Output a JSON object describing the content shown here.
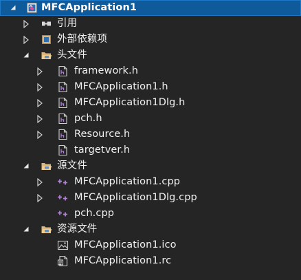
{
  "project": {
    "label": "MFCApplication1",
    "icon": "project-icon"
  },
  "references": {
    "label": "引用",
    "icon": "references-icon"
  },
  "external_dependencies": {
    "label": "外部依赖项",
    "icon": "external-dependencies-icon"
  },
  "header_files": {
    "label": "头文件",
    "icon": "folder-icon",
    "items": [
      {
        "label": "framework.h",
        "icon": "header-file-icon"
      },
      {
        "label": "MFCApplication1.h",
        "icon": "header-file-icon"
      },
      {
        "label": "MFCApplication1Dlg.h",
        "icon": "header-file-icon"
      },
      {
        "label": "pch.h",
        "icon": "header-file-icon"
      },
      {
        "label": "Resource.h",
        "icon": "header-file-icon"
      },
      {
        "label": "targetver.h",
        "icon": "header-file-icon"
      }
    ]
  },
  "source_files": {
    "label": "源文件",
    "icon": "folder-icon",
    "items": [
      {
        "label": "MFCApplication1.cpp",
        "icon": "cpp-file-icon"
      },
      {
        "label": "MFCApplication1Dlg.cpp",
        "icon": "cpp-file-icon"
      },
      {
        "label": "pch.cpp",
        "icon": "cpp-file-icon"
      }
    ]
  },
  "resource_files": {
    "label": "资源文件",
    "icon": "folder-icon",
    "items": [
      {
        "label": "MFCApplication1.ico",
        "icon": "image-file-icon"
      },
      {
        "label": "MFCApplication1.rc",
        "icon": "resource-script-icon"
      }
    ]
  },
  "colors": {
    "background": "#252526",
    "selection": "#0e5a9a",
    "text": "#f1f1f1",
    "folder": "#dcb67a",
    "cpp_accent": "#b180d7"
  }
}
